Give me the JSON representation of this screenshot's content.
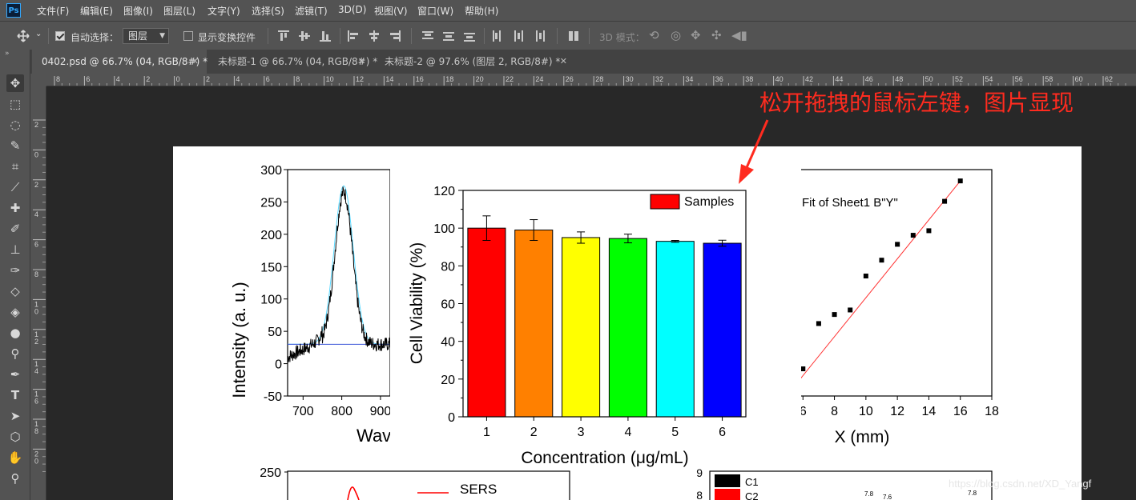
{
  "app": {
    "logo": "Ps"
  },
  "menu": [
    "文件(F)",
    "编辑(E)",
    "图像(I)",
    "图层(L)",
    "文字(Y)",
    "选择(S)",
    "滤镜(T)",
    "3D(D)",
    "视图(V)",
    "窗口(W)",
    "帮助(H)"
  ],
  "options": {
    "auto_select_label": "自动选择：",
    "auto_select_checked": true,
    "auto_select_target": "图层",
    "show_transform_label": "显示变换控件",
    "show_transform_checked": false,
    "mode3d_label": "3D 模式："
  },
  "tabs": [
    {
      "label": "0402.psd @ 66.7% (04, RGB/8#) *",
      "active": true
    },
    {
      "label": "未标题-1 @ 66.7% (04, RGB/8#) *",
      "active": false
    },
    {
      "label": "未标题-2 @ 97.6% (图层 2, RGB/8#) *",
      "active": false
    }
  ],
  "hruler_labels": [
    "8",
    "6",
    "4",
    "2",
    "0",
    "2",
    "4",
    "6",
    "8",
    "10",
    "12",
    "14",
    "16",
    "18",
    "20",
    "22",
    "24",
    "26",
    "28",
    "30",
    "32",
    "34",
    "36",
    "38",
    "40",
    "42",
    "44",
    "46",
    "48",
    "50",
    "52",
    "54",
    "56",
    "58",
    "60",
    "62"
  ],
  "vruler_labels": [
    "2",
    "0",
    "2",
    "4",
    "6",
    "8",
    "10",
    "12",
    "14",
    "16",
    "18",
    "20"
  ],
  "annotation": "松开拖拽的鼠标左键，图片显现",
  "watermark": "https://blog.csdn.net/XD_Yangf",
  "chart_data": [
    {
      "type": "bar",
      "title": "",
      "xlabel": "Concentration (μg/mL)",
      "ylabel": "Cell Viability (%)",
      "categories": [
        "1",
        "2",
        "3",
        "4",
        "5",
        "6"
      ],
      "series": [
        {
          "name": "Samples",
          "values": [
            100,
            99,
            95,
            94.5,
            93,
            92
          ],
          "errors": [
            6.5,
            5.5,
            3,
            2.3,
            0.5,
            1.6
          ]
        }
      ],
      "colors": [
        "#ff0000",
        "#ff8000",
        "#ffff00",
        "#00ff00",
        "#00ffff",
        "#0000ff"
      ],
      "ylim": [
        0,
        120
      ],
      "yticks": [
        "0",
        "20",
        "40",
        "60",
        "80",
        "100",
        "120"
      ],
      "legend": "top-right"
    },
    {
      "type": "line",
      "title": "",
      "xlabel": "Wav",
      "ylabel": "Intensity (a. u.)",
      "xticks": [
        "700",
        "800",
        "900"
      ],
      "yticks": [
        "-50",
        "0",
        "50",
        "100",
        "150",
        "200",
        "250",
        "300"
      ],
      "ylim": [
        -50,
        300
      ],
      "xlim": [
        660,
        925
      ],
      "peak_center": 805,
      "peak_height": 265,
      "baseline": 30
    },
    {
      "type": "scatter",
      "title": "",
      "xlabel": "X (mm)",
      "ylabel": "",
      "legend_text": "Fit of Sheet1 B\"Y\"",
      "xticks": [
        "6",
        "8",
        "10",
        "12",
        "14",
        "16",
        "18"
      ],
      "x": [
        6,
        7,
        8,
        9,
        10,
        11,
        12,
        13,
        14,
        15,
        16
      ],
      "y_rel": [
        0.12,
        0.32,
        0.36,
        0.38,
        0.53,
        0.6,
        0.67,
        0.71,
        0.73,
        0.86,
        0.95
      ]
    },
    {
      "type": "line",
      "title": "",
      "ytick_top": "250",
      "legend": [
        "SERS"
      ]
    },
    {
      "type": "bar",
      "title": "",
      "yticks": [
        "9",
        "8"
      ],
      "legend": [
        "C1",
        "C2"
      ],
      "legend_colors": [
        "#000000",
        "#ff0000"
      ],
      "labels": [
        "7.8",
        "7.6",
        "7.8"
      ]
    }
  ]
}
